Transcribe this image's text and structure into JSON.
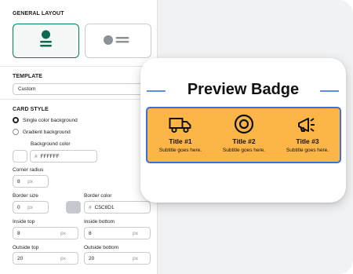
{
  "sections": {
    "general_layout": "GENERAL LAYOUT",
    "template": "TEMPLATE",
    "card_style": "CARD STYLE"
  },
  "template": {
    "value": "Custom"
  },
  "card_style": {
    "single_color": "Single color background",
    "gradient": "Gradient background",
    "background_color_label": "Background color",
    "background_color_value": "FFFFFF",
    "corner_radius_label": "Corner radius",
    "corner_radius_value": "8",
    "border_size_label": "Border size",
    "border_size_value": "0",
    "border_color_label": "Border color",
    "border_color_value": "C5C8D1",
    "inside_top_label": "Inside top",
    "inside_top_value": "8",
    "inside_bottom_label": "Inside bottom",
    "inside_bottom_value": "8",
    "outside_top_label": "Outside top",
    "outside_top_value": "20",
    "outside_bottom_label": "Outside bottom",
    "outside_bottom_value": "20",
    "unit": "px",
    "hash": "#"
  },
  "colors": {
    "accent": "#008060",
    "badge_bg": "#fcb647",
    "badge_border": "#3b6fd9",
    "swatch_border": "#c5c8d1"
  },
  "preview": {
    "title": "Preview Badge",
    "badges": [
      {
        "icon": "truck-icon",
        "title": "Title #1",
        "subtitle": "Subtitle goes here."
      },
      {
        "icon": "target-icon",
        "title": "Title #2",
        "subtitle": "Subtitle goes here."
      },
      {
        "icon": "megaphone-icon",
        "title": "Title #3",
        "subtitle": "Subtitle goes here."
      }
    ]
  }
}
